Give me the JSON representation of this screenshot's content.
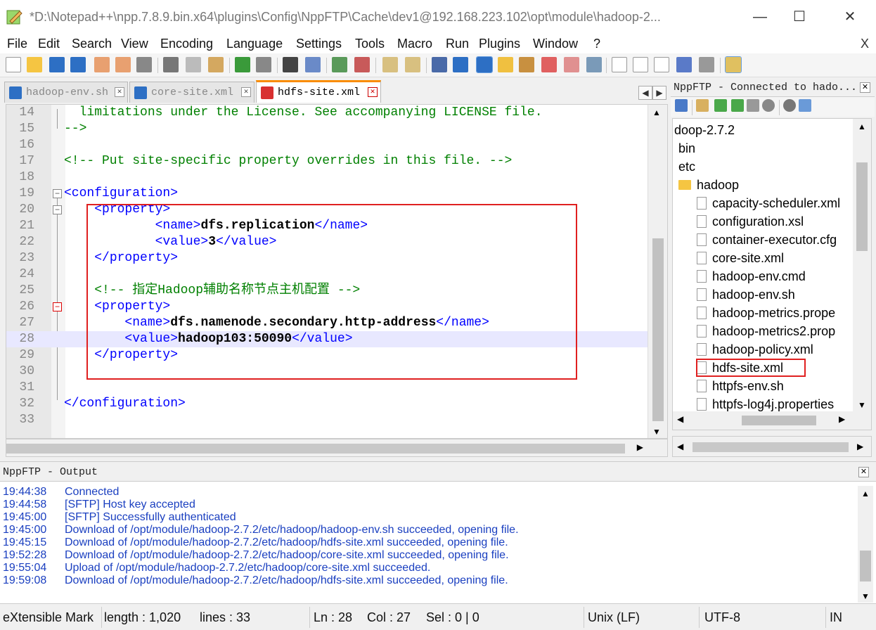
{
  "window": {
    "title": "*D:\\Notepad++\\npp.7.8.9.bin.x64\\plugins\\Config\\NppFTP\\Cache\\dev1@192.168.223.102\\opt\\module\\hadoop-2...",
    "minimize": "—",
    "maximize": "☐",
    "close": "✕"
  },
  "menu": {
    "items": [
      "File",
      "Edit",
      "Search",
      "View",
      "Encoding",
      "Language",
      "Settings",
      "Tools",
      "Macro",
      "Run",
      "Plugins",
      "Window",
      "?"
    ],
    "close": "X"
  },
  "tabs": [
    {
      "label": "hadoop-env.sh",
      "active": false
    },
    {
      "label": "core-site.xml",
      "active": false
    },
    {
      "label": "hdfs-site.xml",
      "active": true
    }
  ],
  "editor": {
    "lines": [
      {
        "n": "14",
        "text": "  limitations under the License. See accompanying LICENSE file."
      },
      {
        "n": "15",
        "text": "-->"
      },
      {
        "n": "16",
        "text": ""
      },
      {
        "n": "17",
        "text": "<!-- Put site-specific property overrides in this file. -->"
      },
      {
        "n": "18",
        "text": ""
      },
      {
        "n": "19",
        "text": "<configuration>"
      },
      {
        "n": "20",
        "pre": "    ",
        "tag1": "<property>"
      },
      {
        "n": "21",
        "pre": "            ",
        "tag1": "<name>",
        "val": "dfs.replication",
        "tag2": "</name>"
      },
      {
        "n": "22",
        "pre": "            ",
        "tag1": "<value>",
        "val": "3",
        "tag2": "</value>"
      },
      {
        "n": "23",
        "pre": "    ",
        "tag1": "</property>"
      },
      {
        "n": "24",
        "text": ""
      },
      {
        "n": "25",
        "text": "    <!-- 指定Hadoop辅助名称节点主机配置 -->"
      },
      {
        "n": "26",
        "pre": "    ",
        "tag1": "<property>"
      },
      {
        "n": "27",
        "pre": "        ",
        "tag1": "<name>",
        "val": "dfs.namenode.secondary.http-address",
        "tag2": "</name>"
      },
      {
        "n": "28",
        "pre": "        ",
        "tag1": "<value>",
        "val": "hadoop103:50090",
        "tag2": "</value>"
      },
      {
        "n": "29",
        "pre": "    ",
        "tag1": "</property>"
      },
      {
        "n": "30",
        "text": ""
      },
      {
        "n": "31",
        "text": ""
      },
      {
        "n": "32",
        "text": "</configuration>"
      },
      {
        "n": "33",
        "text": ""
      }
    ]
  },
  "nppftp": {
    "title": "NppFTP - Connected to hado...",
    "close": "✕",
    "tree": [
      {
        "label": "doop-2.7.2",
        "type": "text"
      },
      {
        "label": "bin",
        "type": "text"
      },
      {
        "label": "etc",
        "type": "text"
      },
      {
        "label": "hadoop",
        "type": "folder"
      },
      {
        "label": "capacity-scheduler.xml",
        "type": "file"
      },
      {
        "label": "configuration.xsl",
        "type": "file"
      },
      {
        "label": "container-executor.cfg",
        "type": "file"
      },
      {
        "label": "core-site.xml",
        "type": "file"
      },
      {
        "label": "hadoop-env.cmd",
        "type": "file"
      },
      {
        "label": "hadoop-env.sh",
        "type": "file"
      },
      {
        "label": "hadoop-metrics.prope",
        "type": "file"
      },
      {
        "label": "hadoop-metrics2.prop",
        "type": "file"
      },
      {
        "label": "hadoop-policy.xml",
        "type": "file"
      },
      {
        "label": "hdfs-site.xml",
        "type": "file"
      },
      {
        "label": "httpfs-env.sh",
        "type": "file"
      },
      {
        "label": "httpfs-log4j.properties",
        "type": "file"
      }
    ]
  },
  "output": {
    "title": "NppFTP - Output",
    "close": "✕",
    "log": [
      {
        "time": "19:44:38",
        "msg": "Connected"
      },
      {
        "time": "19:44:58",
        "msg": "[SFTP] Host key accepted"
      },
      {
        "time": "19:45:00",
        "msg": "[SFTP] Successfully authenticated"
      },
      {
        "time": "19:45:00",
        "msg": "Download of /opt/module/hadoop-2.7.2/etc/hadoop/hadoop-env.sh succeeded, opening file."
      },
      {
        "time": "19:45:15",
        "msg": "Download of /opt/module/hadoop-2.7.2/etc/hadoop/hdfs-site.xml succeeded, opening file."
      },
      {
        "time": "19:52:28",
        "msg": "Download of /opt/module/hadoop-2.7.2/etc/hadoop/core-site.xml succeeded, opening file."
      },
      {
        "time": "19:55:04",
        "msg": "Upload of /opt/module/hadoop-2.7.2/etc/hadoop/core-site.xml succeeded."
      },
      {
        "time": "19:59:08",
        "msg": "Download of /opt/module/hadoop-2.7.2/etc/hadoop/hdfs-site.xml succeeded, opening file."
      }
    ]
  },
  "status": {
    "lang": "eXtensible Mark",
    "length": "length : 1,020",
    "lines": "lines : 33",
    "ln": "Ln : 28",
    "col": "Col : 27",
    "sel": "Sel : 0 | 0",
    "eol": "Unix (LF)",
    "enc": "UTF-8",
    "ins": "IN"
  },
  "colors": {
    "comment": "#008000",
    "tag": "#0000ff",
    "highlight": "#e8e8ff",
    "annotation": "#e02020",
    "log": "#1a3fc0"
  }
}
